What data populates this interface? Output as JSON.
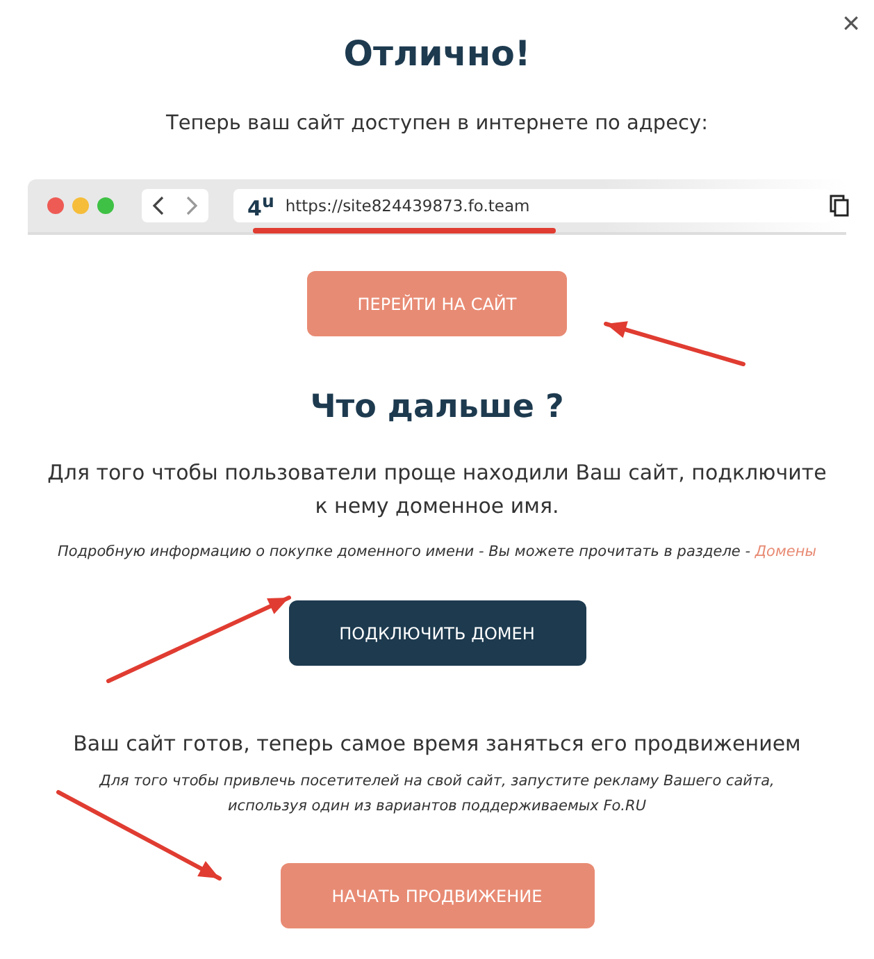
{
  "close": "×",
  "title": "Отлично!",
  "subtitle": "Теперь ваш сайт доступен в интернете по адресу:",
  "browser": {
    "logo": "4$^{u}$",
    "url": "https://site824439873.fo.team"
  },
  "visit_button": "ПЕРЕЙТИ НА САЙТ",
  "next_heading": "Что дальше ?",
  "next_text": "Для того чтобы пользователи проще находили Ваш сайт, подключите к нему доменное имя.",
  "domain_note": {
    "text": "Подробную информацию о покупке доменного имени - Вы можете прочитать в разделе - ",
    "link": "Домены"
  },
  "domain_button": "ПОДКЛЮЧИТЬ ДОМЕН",
  "promo_text": "Ваш сайт готов, теперь самое время заняться его продвижением",
  "promo_note": "Для того чтобы привлечь посетителей на свой сайт, запустите рекламу Вашего сайта, используя один из вариантов поддерживаемых Fo.RU",
  "promo_button": "НАЧАТЬ ПРОДВИЖЕНИЕ"
}
